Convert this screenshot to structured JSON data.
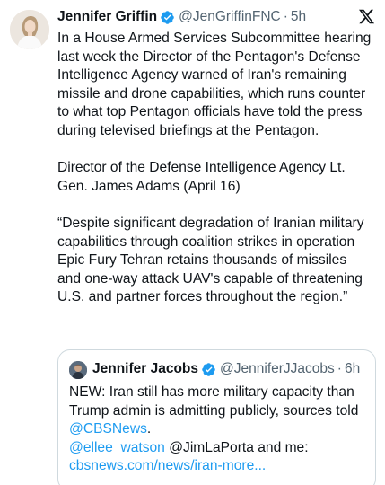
{
  "author": {
    "name": "Jennifer Griffin",
    "handle": "@JenGriffinFNC",
    "separator": "·",
    "time": "5h",
    "verified_icon": "verified-badge-icon",
    "verified_color": "#1d9bf0"
  },
  "tweet": {
    "paragraphs": [
      "In a House Armed Services Subcommittee hearing last week the Director of the Pentagon's Defense Intelligence Agency warned of Iran's remaining missile and drone capabilities, which runs counter to what top Pentagon officials have told the press during televised briefings at the Pentagon.",
      "Director of the Defense Intelligence Agency Lt. Gen. James Adams (April 16)",
      "“Despite significant degradation of Iranian military capabilities through coalition strikes in operation Epic Fury Tehran retains thousands of missiles and one-way attack UAV's capable of threatening U.S. and partner forces throughout the region.”"
    ]
  },
  "quoted": {
    "name": "Jennifer Jacobs",
    "handle": "@JenniferJJacobs",
    "separator": "·",
    "time": "6h",
    "text_before": "NEW: Iran still has more military capacity than Trump admin is admitting publicly, sources told ",
    "mention_cbs": "@CBSNews",
    "text_period": ".",
    "mention_ellee": "@ellee_watson",
    "text_mid": " @JimLaPorta and me:",
    "link_text": "cbsnews.com/news/iran-more..."
  },
  "brand": {
    "logo_icon": "x-logo-icon",
    "link_color": "#1d9bf0"
  }
}
